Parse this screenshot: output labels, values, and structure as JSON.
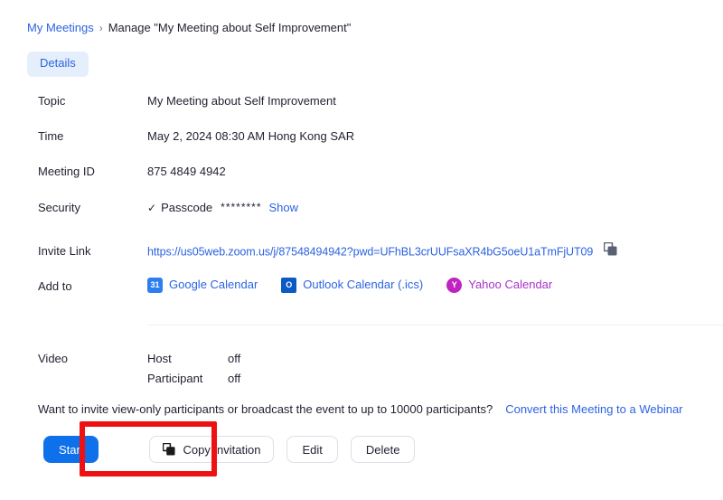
{
  "breadcrumb": {
    "parent": "My Meetings",
    "separator": "›",
    "current": "Manage \"My Meeting about Self Improvement\""
  },
  "tabs": [
    {
      "label": "Details",
      "active": true
    }
  ],
  "details": {
    "topic": {
      "label": "Topic",
      "value": "My Meeting about Self Improvement"
    },
    "time": {
      "label": "Time",
      "value": "May 2, 2024 08:30 AM Hong Kong SAR"
    },
    "meeting_id": {
      "label": "Meeting ID",
      "value": "875 4849 4942"
    },
    "security": {
      "label": "Security",
      "check_glyph": "✓",
      "passcode_label": "Passcode",
      "passcode_masked": "********",
      "show_link": "Show"
    },
    "invite_link": {
      "label": "Invite Link",
      "url": "https://us05web.zoom.us/j/87548494942?pwd=UFhBL3crUUFsaXR4bG5oeU1aTmFjUT09",
      "copy_icon": "copy-icon"
    },
    "add_to": {
      "label": "Add to",
      "calendars": [
        {
          "name": "Google Calendar",
          "icon": "google-calendar-icon",
          "icon_glyph": "31",
          "color": "#2d63e2"
        },
        {
          "name": "Outlook Calendar (.ics)",
          "icon": "outlook-calendar-icon",
          "icon_glyph": "O",
          "color": "#2d63e2"
        },
        {
          "name": "Yahoo Calendar",
          "icon": "yahoo-calendar-icon",
          "icon_glyph": "Y",
          "color": "#a832c8"
        }
      ]
    },
    "video": {
      "label": "Video",
      "rows": [
        {
          "key": "Host",
          "value": "off"
        },
        {
          "key": "Participant",
          "value": "off"
        }
      ]
    }
  },
  "webinar_note": {
    "text": "Want to invite view-only participants or broadcast the event to up to 10000 participants?",
    "link": "Convert this Meeting to a Webinar"
  },
  "actions": {
    "start": "Start",
    "copy_invitation": "Copy Invitation",
    "edit": "Edit",
    "delete": "Delete"
  },
  "colors": {
    "primary_blue": "#0e71eb",
    "link_blue": "#2d63e2",
    "tab_bg": "#e5effc",
    "yahoo_purple": "#a832c8",
    "highlight_red": "#ee1111"
  }
}
